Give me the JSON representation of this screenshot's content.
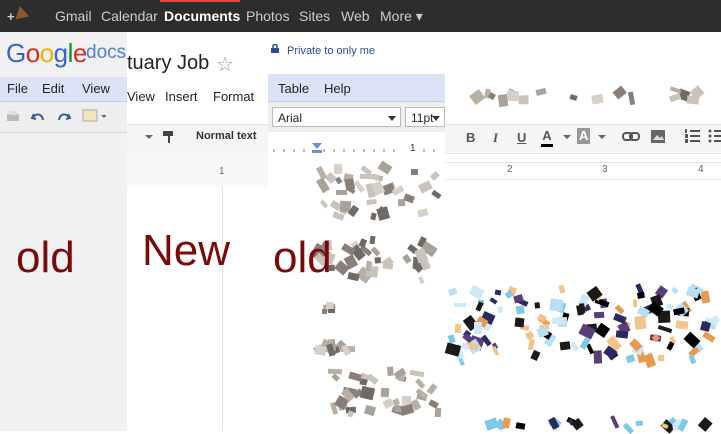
{
  "topbar": {
    "plus": "+",
    "links": [
      "Gmail",
      "Calendar",
      "Documents",
      "Photos",
      "Sites",
      "Web",
      "More ▾"
    ],
    "active": "Documents"
  },
  "logo": {
    "google": "Google",
    "product": "docs"
  },
  "document": {
    "title": "tuary Job",
    "privacy": "Private to only me"
  },
  "old_menu": [
    "File",
    "Edit",
    "View"
  ],
  "new_menu": [
    "View",
    "Insert",
    "Format"
  ],
  "old_menu_right": [
    "Table",
    "Help"
  ],
  "toolbar": {
    "style": "Normal text",
    "font": "Arial",
    "size": "11pt"
  },
  "ruler": {
    "old_tick": "1",
    "new_ticks": [
      "1",
      "2",
      "3",
      "4"
    ]
  },
  "labels": {
    "left": "old",
    "middle": "New",
    "right": "old"
  },
  "colors": {
    "topbar": "#2d2d2d",
    "label": "#7a0a0a",
    "menubar": "#dce3f7",
    "privacy": "#2b4b93"
  },
  "icons": [
    "undo-icon",
    "redo-icon",
    "paint-format-icon",
    "bold-icon",
    "italic-icon",
    "underline-icon",
    "text-color-icon",
    "highlight-icon",
    "link-icon",
    "image-icon",
    "numbered-list-icon",
    "bulleted-list-icon",
    "star-icon",
    "lock-icon"
  ]
}
